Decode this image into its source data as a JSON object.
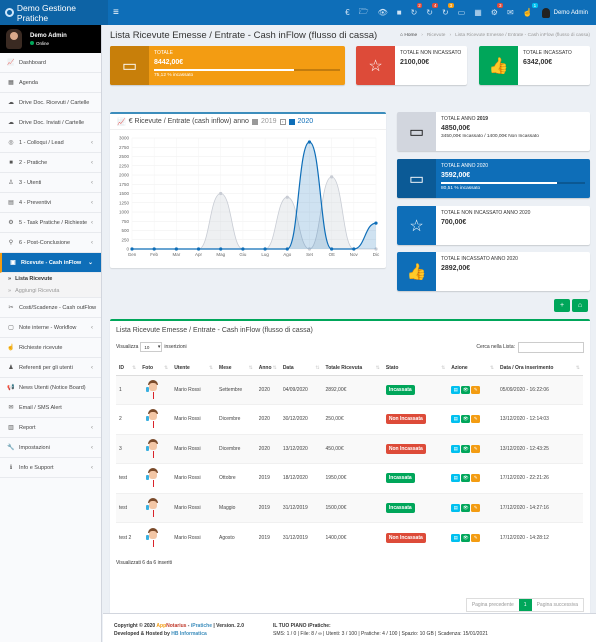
{
  "app": {
    "title": "Demo Gestione Pratiche",
    "menu_toggle_icon": "hamburger-icon"
  },
  "topbar": {
    "icons": [
      {
        "name": "euro-icon",
        "glyph": "€",
        "badge": null
      },
      {
        "name": "folder-icon",
        "glyph": "🗁",
        "badge": null
      },
      {
        "name": "eye-icon",
        "glyph": "👁",
        "badge": null
      },
      {
        "name": "square-icon",
        "glyph": "■",
        "badge": null
      },
      {
        "name": "refresh-icon",
        "glyph": "↻",
        "badge": "2",
        "badge_color": "#dd4b39"
      },
      {
        "name": "refresh-icon",
        "glyph": "↻",
        "badge": "4",
        "badge_color": "#dd4b39"
      },
      {
        "name": "refresh-icon",
        "glyph": "↻",
        "badge": "3",
        "badge_color": "#f39c12"
      },
      {
        "name": "calendar-icon",
        "glyph": "▭",
        "badge": null
      },
      {
        "name": "calendar-grid-icon",
        "glyph": "▦",
        "badge": null
      },
      {
        "name": "cogs-icon",
        "glyph": "⚙",
        "badge": "3",
        "badge_color": "#dd4b39"
      },
      {
        "name": "envelope-icon",
        "glyph": "✉",
        "badge": null
      },
      {
        "name": "hand-icon",
        "glyph": "☝",
        "badge": "1",
        "badge_color": "#00c0ef"
      }
    ],
    "user_name": "Demo Admin"
  },
  "sidebar": {
    "user": {
      "name": "Demo Admin",
      "status": "Online"
    },
    "items": [
      {
        "label": "Dashboard",
        "icon": "chart-line-icon",
        "glyph": "📈",
        "chevron": false
      },
      {
        "label": "Agenda",
        "icon": "calendar-icon",
        "glyph": "▦",
        "chevron": false
      },
      {
        "label": "Drive Doc. Ricevuti / Cartelle",
        "icon": "cloud-download-icon",
        "glyph": "☁",
        "chevron": false
      },
      {
        "label": "Drive Doc. Inviati / Cartelle",
        "icon": "cloud-upload-icon",
        "glyph": "☁",
        "chevron": false
      },
      {
        "label": "1 - Colloqui / Lead",
        "icon": "eye-icon",
        "glyph": "◎",
        "chevron": true
      },
      {
        "label": "2 - Pratiche",
        "icon": "folder-icon",
        "glyph": "■",
        "chevron": true
      },
      {
        "label": "3 - Utenti",
        "icon": "user-icon",
        "glyph": "♙",
        "chevron": true
      },
      {
        "label": "4 - Preventivi",
        "icon": "document-icon",
        "glyph": "▤",
        "chevron": true
      },
      {
        "label": "5 - Task Pratiche / Richieste",
        "icon": "cogs-icon",
        "glyph": "⚙",
        "chevron": true
      },
      {
        "label": "6 - Post-Conclusione",
        "icon": "pin-icon",
        "glyph": "⚲",
        "chevron": true
      },
      {
        "label": "Ricevute - Cash inFlow",
        "icon": "money-icon",
        "glyph": "▣",
        "chevron": true,
        "active": true
      },
      {
        "label": "Costi/Scadenze - Cash outFlow",
        "icon": "scissors-icon",
        "glyph": "✂",
        "chevron": true
      },
      {
        "label": "Note interne - Workflow",
        "icon": "note-icon",
        "glyph": "▢",
        "chevron": true
      },
      {
        "label": "Richieste ricevute",
        "icon": "hand-icon",
        "glyph": "☝",
        "chevron": false
      },
      {
        "label": "Referenti per gli utenti",
        "icon": "users-icon",
        "glyph": "♟",
        "chevron": true
      },
      {
        "label": "News Utenti (Notice Board)",
        "icon": "bullhorn-icon",
        "glyph": "📢",
        "chevron": false
      },
      {
        "label": "Email / SMS Alert",
        "icon": "envelope-icon",
        "glyph": "✉",
        "chevron": false
      },
      {
        "label": "Report",
        "icon": "bar-chart-icon",
        "glyph": "▥",
        "chevron": true
      },
      {
        "label": "Impostazioni",
        "icon": "wrench-icon",
        "glyph": "🔧",
        "chevron": true
      },
      {
        "label": "Info e Support",
        "icon": "info-icon",
        "glyph": "ℹ",
        "chevron": true
      }
    ],
    "submenu": [
      {
        "label": "Lista Ricevute",
        "current": true
      },
      {
        "label": "Aggiungi Ricevuta",
        "current": false
      }
    ]
  },
  "header": {
    "title": "Lista Ricevute Emesse / Entrate - Cash inFlow (flusso di cassa)",
    "breadcrumb": [
      "Home",
      "Ricevute",
      "Lista Ricevute Emesse / Entrate - Cash inFlow (flusso di cassa)"
    ]
  },
  "stats": {
    "totale": {
      "label": "TOTALE",
      "value": "8442,00€",
      "sub": "75,12 % incassato",
      "progress_pct": 75.12,
      "color": "#f39c12",
      "icon_bg": "#c87f0a"
    },
    "non_incassato": {
      "label": "TOTALE NON INCASSATO",
      "value": "2100,00€",
      "color": "#dd4b39"
    },
    "incassato": {
      "label": "TOTALE INCASSATO",
      "value": "6342,00€",
      "color": "#00a65a"
    },
    "anno_2019": {
      "label_prefix": "TOTALE ANNO ",
      "year": "2019",
      "value": "4850,00€",
      "sub": "3450,00€ Incassato / 1400,00€ Non Incassato",
      "icon_bg": "#d2d6de"
    },
    "anno_2020": {
      "label": "TOTALE ANNO 2020",
      "value": "3592,00€",
      "sub": "80,51 % incassato",
      "progress_pct": 80.51,
      "color": "#0e6eb8",
      "icon_bg": "#0b5a96"
    },
    "non_incassato_2020": {
      "label": "TOTALE NON INCASSATO ANNO 2020",
      "value": "700,00€",
      "icon_bg": "#0e6eb8"
    },
    "incassato_2020": {
      "label": "TOTALE INCASSATO ANNO 2020",
      "value": "2892,00€",
      "icon_bg": "#0e6eb8"
    }
  },
  "buttons": {
    "add_icon": "plus-icon",
    "home_icon": "bank-icon"
  },
  "chart_data": {
    "type": "area",
    "title": "€ Ricevute / Entrate (cash inflow) anno",
    "categories": [
      "Gen",
      "Feb",
      "Mar",
      "Apr",
      "Mag",
      "Giu",
      "Lug",
      "Ago",
      "Set",
      "Ott",
      "Nov",
      "Dic"
    ],
    "series": [
      {
        "name": "2019",
        "color": "#c8ccd4",
        "values": [
          0,
          0,
          0,
          0,
          1500,
          0,
          0,
          1400,
          0,
          1950,
          0,
          0
        ]
      },
      {
        "name": "2020",
        "color": "#0e6eb8",
        "values": [
          0,
          0,
          0,
          0,
          0,
          0,
          0,
          0,
          2892,
          0,
          0,
          700
        ]
      }
    ],
    "yticks": [
      0,
      250,
      500,
      750,
      1000,
      1250,
      1500,
      1750,
      2000,
      2250,
      2500,
      2750,
      3000
    ],
    "ylim": [
      0,
      3000
    ],
    "grid": true,
    "legend": "top"
  },
  "list": {
    "title": "Lista Ricevute Emesse / Entrate - Cash inFlow (flusso di cassa)",
    "show_label": "Visualizza",
    "show_value": "10",
    "entries_label": "inserizioni",
    "search_label": "Cerca nella Lista:",
    "search_value": "",
    "columns": [
      "ID",
      "Foto",
      "Utente",
      "Mese",
      "Anno",
      "Data",
      "Totale Ricevuta",
      "Stato",
      "Azione",
      "Data / Ora inserimento"
    ],
    "rows": [
      {
        "id": "1",
        "utente": "Mario Rossi",
        "mese": "Settembre",
        "anno": "2020",
        "data": "04/09/2020",
        "totale": "2892,00€",
        "stato": "Incassata",
        "stato_color": "#00a65a",
        "inserimento": "05/09/2020 - 16:22:06"
      },
      {
        "id": "2",
        "utente": "Mario Rossi",
        "mese": "Dicembre",
        "anno": "2020",
        "data": "30/12/2020",
        "totale": "250,00€",
        "stato": "Non Incassata",
        "stato_color": "#dd4b39",
        "inserimento": "13/12/2020 - 12:14:03"
      },
      {
        "id": "3",
        "utente": "Mario Rossi",
        "mese": "Dicembre",
        "anno": "2020",
        "data": "13/12/2020",
        "totale": "450,00€",
        "stato": "Non Incassata",
        "stato_color": "#dd4b39",
        "inserimento": "13/12/2020 - 12:43:25"
      },
      {
        "id": "test",
        "utente": "Mario Rossi",
        "mese": "Ottobre",
        "anno": "2019",
        "data": "18/12/2020",
        "totale": "1950,00€",
        "stato": "Incassata",
        "stato_color": "#00a65a",
        "inserimento": "17/12/2020 - 22:21:26"
      },
      {
        "id": "test",
        "utente": "Mario Rossi",
        "mese": "Maggio",
        "anno": "2019",
        "data": "31/12/2019",
        "totale": "1500,00€",
        "stato": "Incassata",
        "stato_color": "#00a65a",
        "inserimento": "17/12/2020 - 14:27:16"
      },
      {
        "id": "test 2",
        "utente": "Mario Rossi",
        "mese": "Agosto",
        "anno": "2019",
        "data": "31/12/2019",
        "totale": "1400,00€",
        "stato": "Non Incassata",
        "stato_color": "#dd4b39",
        "inserimento": "17/12/2020 - 14:28:12"
      }
    ],
    "info": "Visualizzati 6 da 6 inseriti",
    "pager": {
      "prev": "Pagina precedente",
      "current": "1",
      "next": "Pagina successiva"
    }
  },
  "footer": {
    "copyright_prefix": "Copyright © 2020 ",
    "brand_app": "App",
    "brand_notarius": "Notarius",
    "sep": " - ",
    "brand_ipratiche": "iPratiche",
    "version": " | Version. 2.0",
    "developed_prefix": "Developed & Hosted by ",
    "developer": "HB Informatica",
    "plan_title": "IL TUO PIANO iPratiche:",
    "plan_line": "SMS: 1 / 0 | File: 8 / ∞ | Utenti: 3 / 100 | Pratiche: 4 / 100 | Spazio: 10 GB | Scadenza: 15/01/2021"
  }
}
